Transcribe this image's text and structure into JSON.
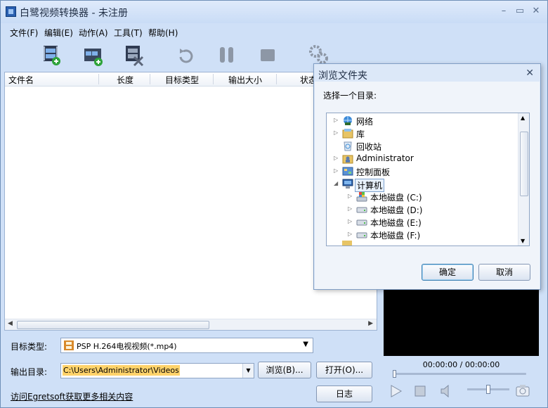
{
  "window": {
    "title": "白鹭视频转换器 - 未注册",
    "min": "–",
    "max": "▭",
    "close": "✕"
  },
  "menu": [
    "文件(F)",
    "编辑(E)",
    "动作(A)",
    "工具(T)",
    "帮助(H)"
  ],
  "toolbar": [
    "add-video",
    "add-folder",
    "remove",
    "refresh",
    "pause",
    "stop",
    "settings"
  ],
  "list": {
    "columns": [
      "文件名",
      "长度",
      "目标类型",
      "输出大小",
      "状态"
    ],
    "rows": [],
    "scroll_left": "◀",
    "scroll_right": "▶"
  },
  "target_type": {
    "label": "目标类型:",
    "value": "PSP H.264电视视频(*.mp4)"
  },
  "output_dir": {
    "label": "输出目录:",
    "value": "C:\\Users\\Administrator\\Videos",
    "browse": "浏览(B)...",
    "open": "打开(O)..."
  },
  "footer": {
    "link": "访问Egretsoft获取更多相关内容",
    "log": "日志"
  },
  "player": {
    "time": "00:00:00 / 00:00:00"
  },
  "dialog": {
    "title": "浏览文件夹",
    "prompt": "选择一个目录:",
    "tree": [
      {
        "label": "网络",
        "icon": "network-icon",
        "expandable": true,
        "level": 0
      },
      {
        "label": "库",
        "icon": "library-icon",
        "expandable": true,
        "level": 0
      },
      {
        "label": "回收站",
        "icon": "recycle-bin-icon",
        "expandable": false,
        "level": 0
      },
      {
        "label": "Administrator",
        "icon": "user-folder-icon",
        "expandable": true,
        "level": 0
      },
      {
        "label": "控制面板",
        "icon": "control-panel-icon",
        "expandable": true,
        "level": 0
      },
      {
        "label": "计算机",
        "icon": "computer-icon",
        "expandable": true,
        "expanded": true,
        "selected": true,
        "level": 0
      },
      {
        "label": "本地磁盘 (C:)",
        "icon": "system-drive-icon",
        "expandable": true,
        "level": 1
      },
      {
        "label": "本地磁盘 (D:)",
        "icon": "drive-icon",
        "expandable": true,
        "level": 1
      },
      {
        "label": "本地磁盘 (E:)",
        "icon": "drive-icon",
        "expandable": true,
        "level": 1
      },
      {
        "label": "本地磁盘 (F:)",
        "icon": "drive-icon",
        "expandable": true,
        "level": 1
      }
    ],
    "ok": "确定",
    "cancel": "取消",
    "close": "✕"
  },
  "colors": {
    "accent": "#2a5fb0",
    "selection": "#ffd36b",
    "window_bg": "#cfe0f7"
  }
}
